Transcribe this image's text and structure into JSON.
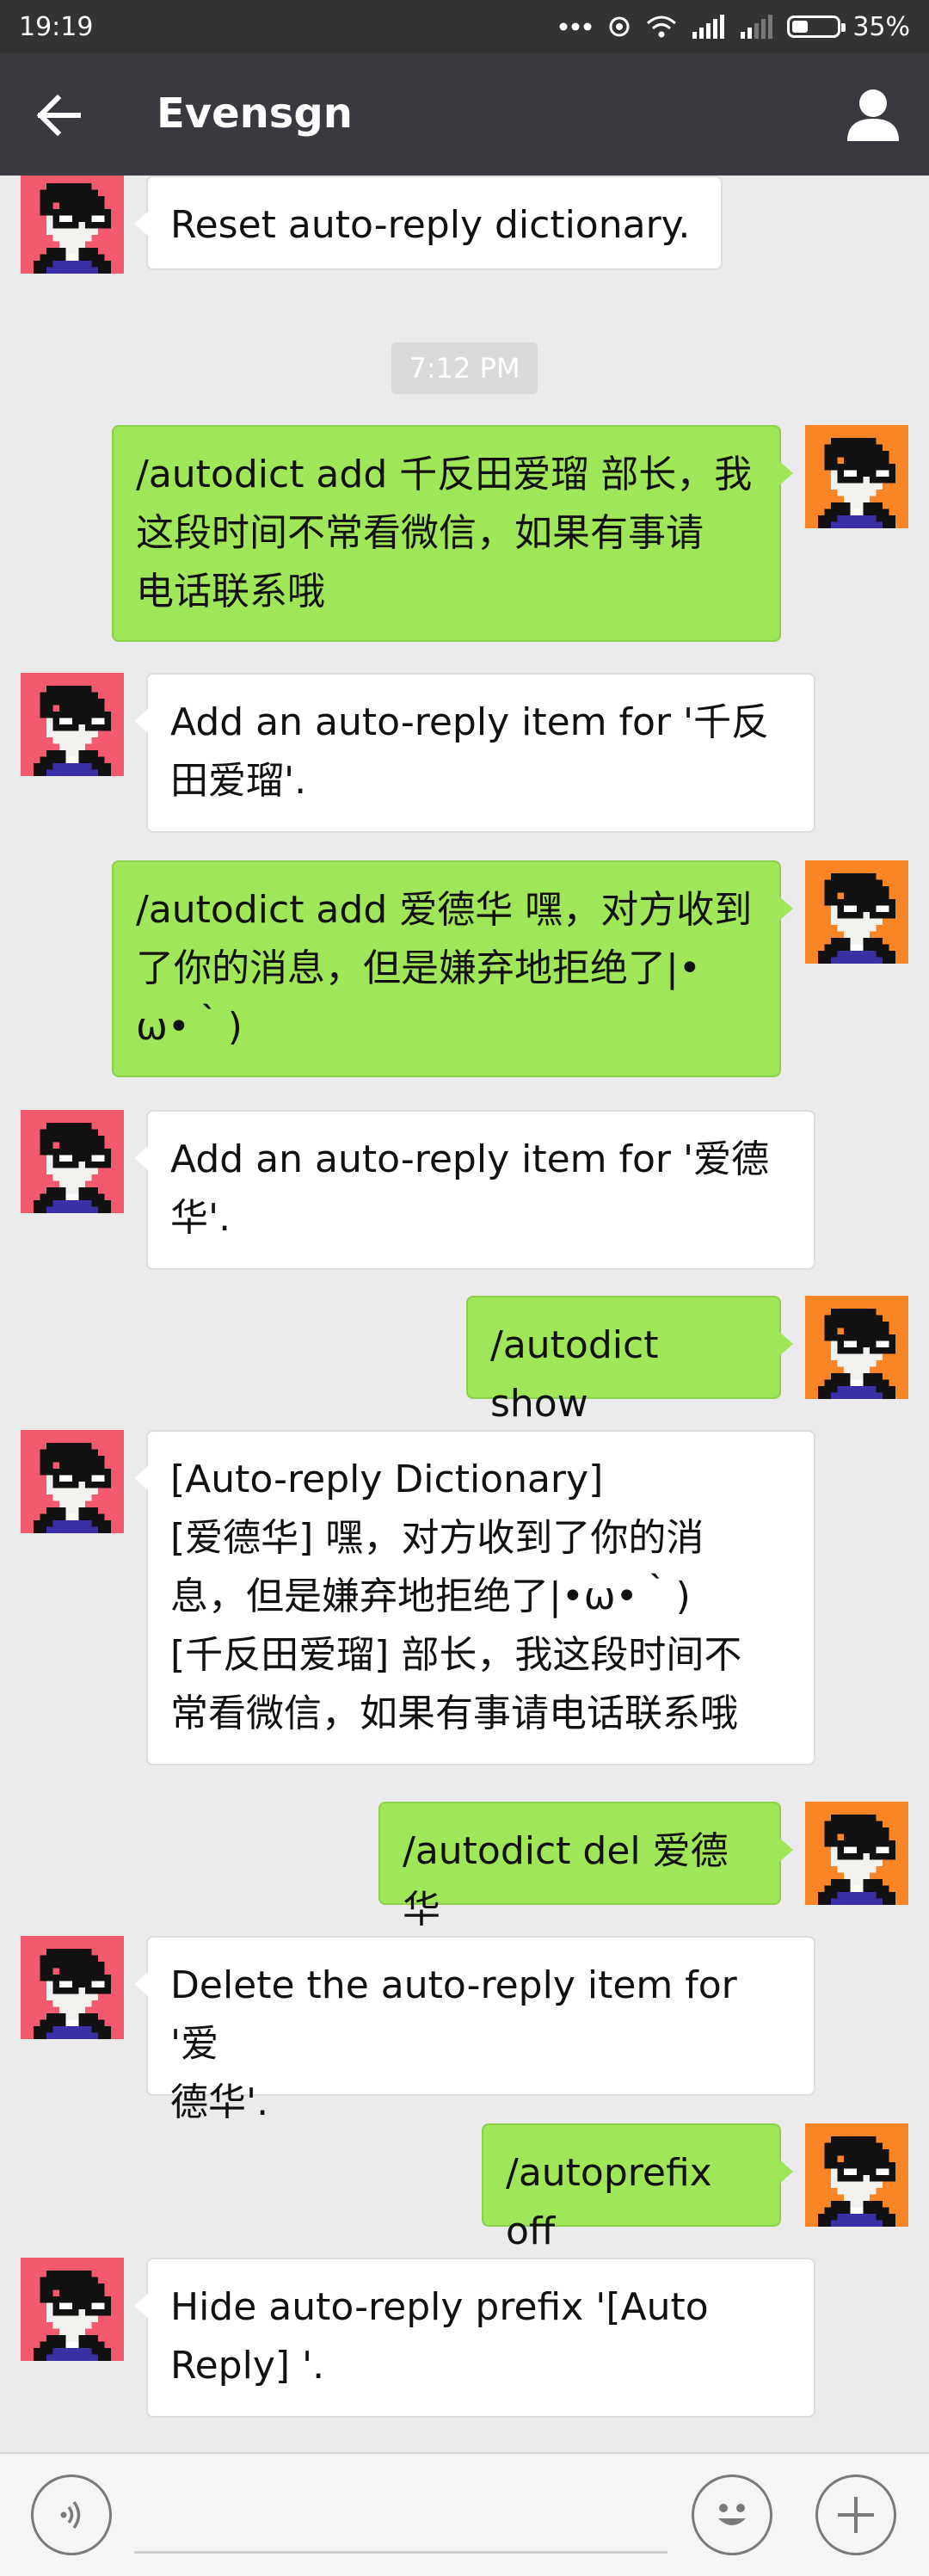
{
  "status_bar": {
    "time": "19:19",
    "battery": "35%",
    "battery_level": 0.35
  },
  "header": {
    "title": "Evensgn"
  },
  "chat": {
    "timestamp": "7:12 PM",
    "messages": [
      {
        "sender": "bot",
        "text": "Reset auto-reply dictionary."
      },
      {
        "sender": "user",
        "text": "/autodict add 千反田爱瑠 部长，我\n这段时间不常看微信，如果有事请\n电话联系哦"
      },
      {
        "sender": "bot",
        "text": "Add an auto-reply item for '千反\n田爱瑠'."
      },
      {
        "sender": "user",
        "text": "/autodict add 爱德华 嘿，对方收到\n了你的消息，但是嫌弃地拒绝了|•\nω•｀)"
      },
      {
        "sender": "bot",
        "text": "Add an auto-reply item for '爱德\n华'."
      },
      {
        "sender": "user",
        "text": "/autodict show"
      },
      {
        "sender": "bot",
        "text": "[Auto-reply Dictionary]\n[爱德华] 嘿，对方收到了你的消\n息，但是嫌弃地拒绝了|•ω•｀)\n[千反田爱瑠] 部长，我这段时间不\n常看微信，如果有事请电话联系哦"
      },
      {
        "sender": "user",
        "text": "/autodict del 爱德华"
      },
      {
        "sender": "bot",
        "text": "Delete the auto-reply item for '爱\n德华'."
      },
      {
        "sender": "user",
        "text": "/autoprefix off"
      },
      {
        "sender": "bot",
        "text": "Hide auto-reply prefix '[Auto\nReply] '."
      }
    ]
  },
  "colors": {
    "status_bar_bg": "#333333",
    "title_bar_bg": "#393a3f",
    "chat_bg": "#ebebeb",
    "outgoing_bubble": "#9fe658",
    "incoming_bubble": "#ffffff",
    "bot_avatar_bg": "#f45a6e",
    "user_avatar_bg": "#f98527"
  },
  "icons": {
    "back": "arrow-left-icon",
    "profile": "user-icon",
    "voice": "voice-icon",
    "emoji": "emoji-icon",
    "more": "plus-icon"
  }
}
